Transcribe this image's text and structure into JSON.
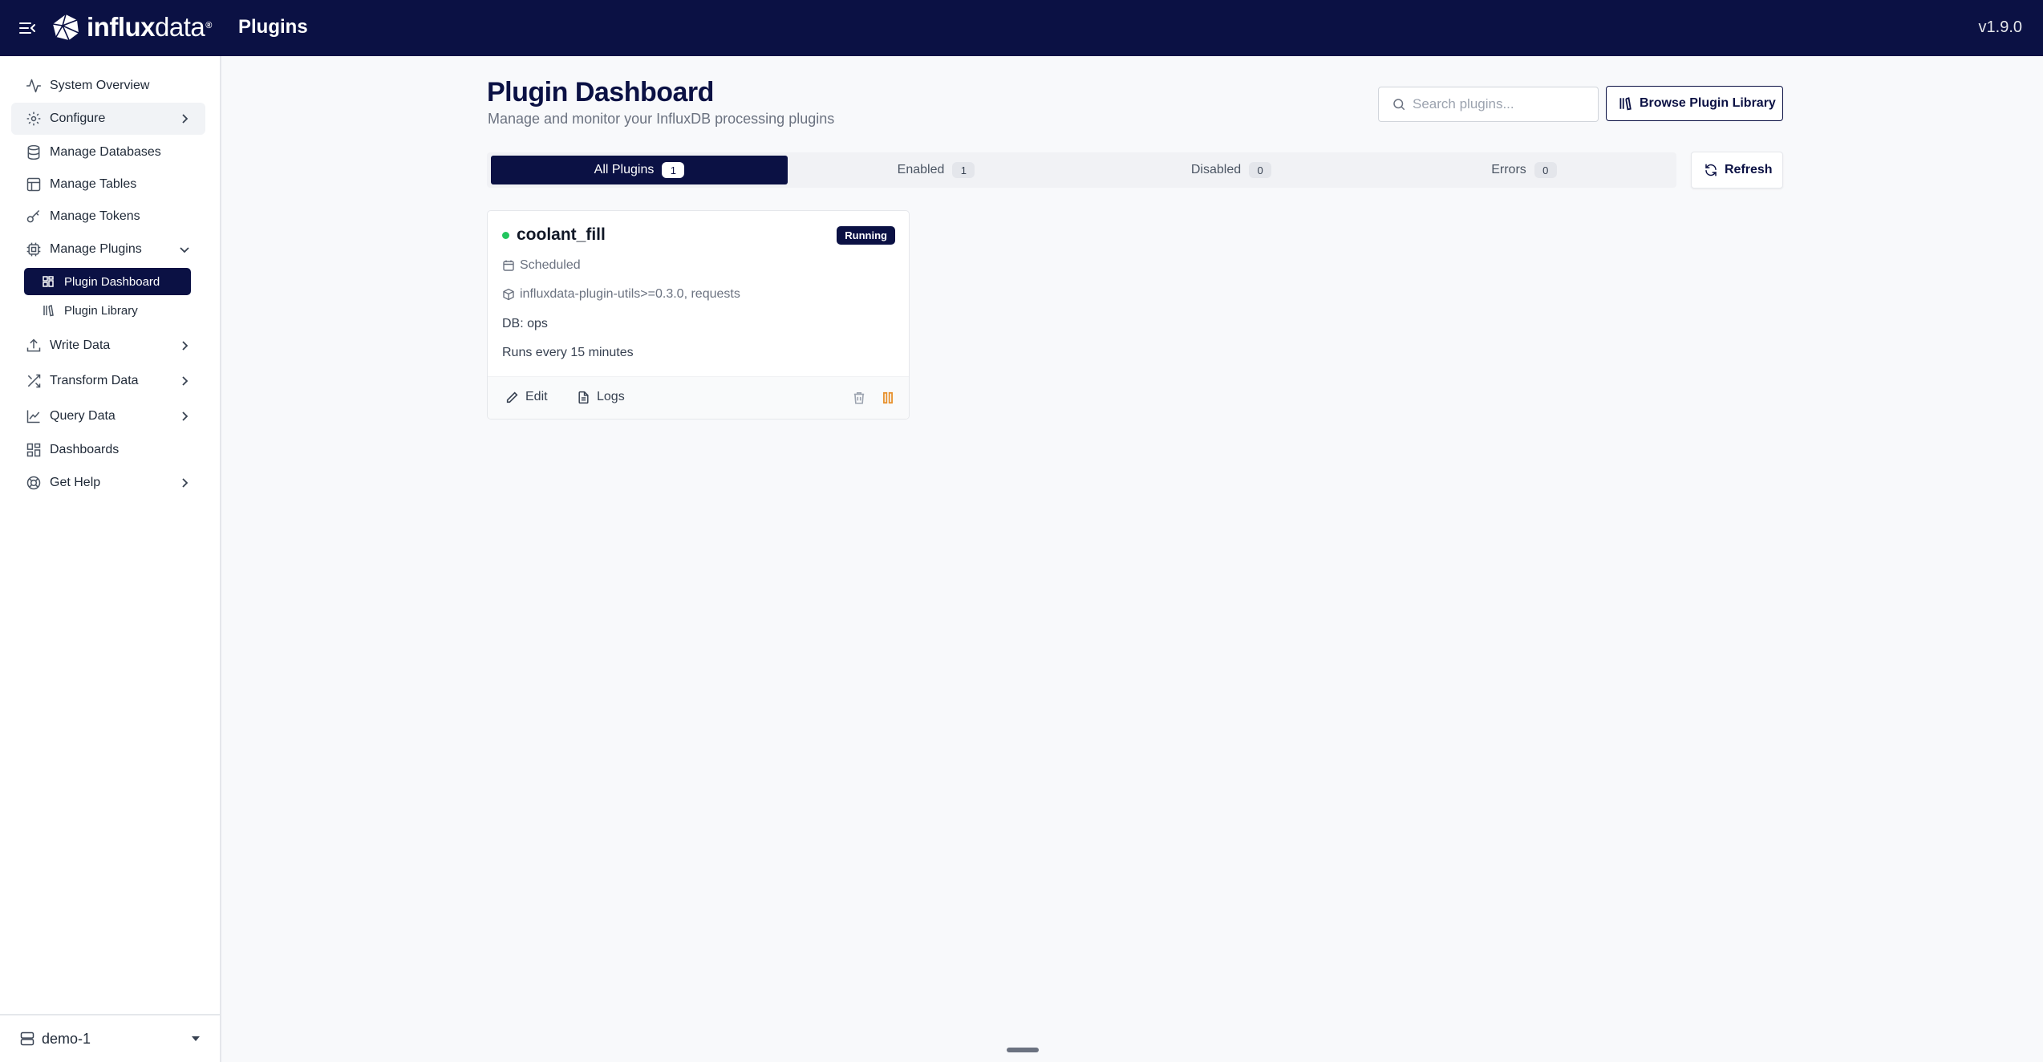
{
  "header": {
    "brand_bold": "influx",
    "brand_light": "data",
    "brand_reg": "®",
    "page_name": "Plugins",
    "version": "v1.9.0"
  },
  "sidebar": {
    "items": [
      {
        "label": "System Overview",
        "icon": "activity-icon"
      },
      {
        "label": "Configure",
        "icon": "gear-icon",
        "chevron": "right"
      },
      {
        "label": "Manage Databases",
        "icon": "database-icon"
      },
      {
        "label": "Manage Tables",
        "icon": "table-icon"
      },
      {
        "label": "Manage Tokens",
        "icon": "key-icon"
      },
      {
        "label": "Manage Plugins",
        "icon": "cpu-icon",
        "chevron": "down"
      },
      {
        "label": "Write Data",
        "icon": "upload-icon",
        "chevron": "right"
      },
      {
        "label": "Transform Data",
        "icon": "shuffle-icon",
        "chevron": "right"
      },
      {
        "label": "Query Data",
        "icon": "line-chart-icon",
        "chevron": "right"
      },
      {
        "label": "Dashboards",
        "icon": "grid-icon"
      },
      {
        "label": "Get Help",
        "icon": "lifebuoy-icon",
        "chevron": "right"
      }
    ],
    "sub_items": [
      {
        "label": "Plugin Dashboard",
        "icon": "dashboard-icon",
        "active": true
      },
      {
        "label": "Plugin Library",
        "icon": "library-icon",
        "active": false
      }
    ],
    "footer": {
      "label": "demo-1",
      "icon": "server-icon"
    }
  },
  "main": {
    "title": "Plugin Dashboard",
    "subtitle": "Manage and monitor your InfluxDB processing plugins",
    "search_placeholder": "Search plugins...",
    "browse_label": "Browse Plugin Library",
    "refresh_label": "Refresh",
    "tabs": [
      {
        "label": "All Plugins",
        "count": "1",
        "active": true
      },
      {
        "label": "Enabled",
        "count": "1",
        "active": false
      },
      {
        "label": "Disabled",
        "count": "0",
        "active": false
      },
      {
        "label": "Errors",
        "count": "0",
        "active": false
      }
    ]
  },
  "plugins": [
    {
      "name": "coolant_fill",
      "status": "Running",
      "status_color": "#22c55e",
      "trigger_type": "Scheduled",
      "dependencies": "influxdata-plugin-utils>=0.3.0, requests",
      "db": "DB: ops",
      "schedule": "Runs every 15 minutes",
      "actions": {
        "edit": "Edit",
        "logs": "Logs"
      }
    }
  ],
  "colors": {
    "navy": "#0b1144",
    "pause_orange": "#e8912d"
  }
}
